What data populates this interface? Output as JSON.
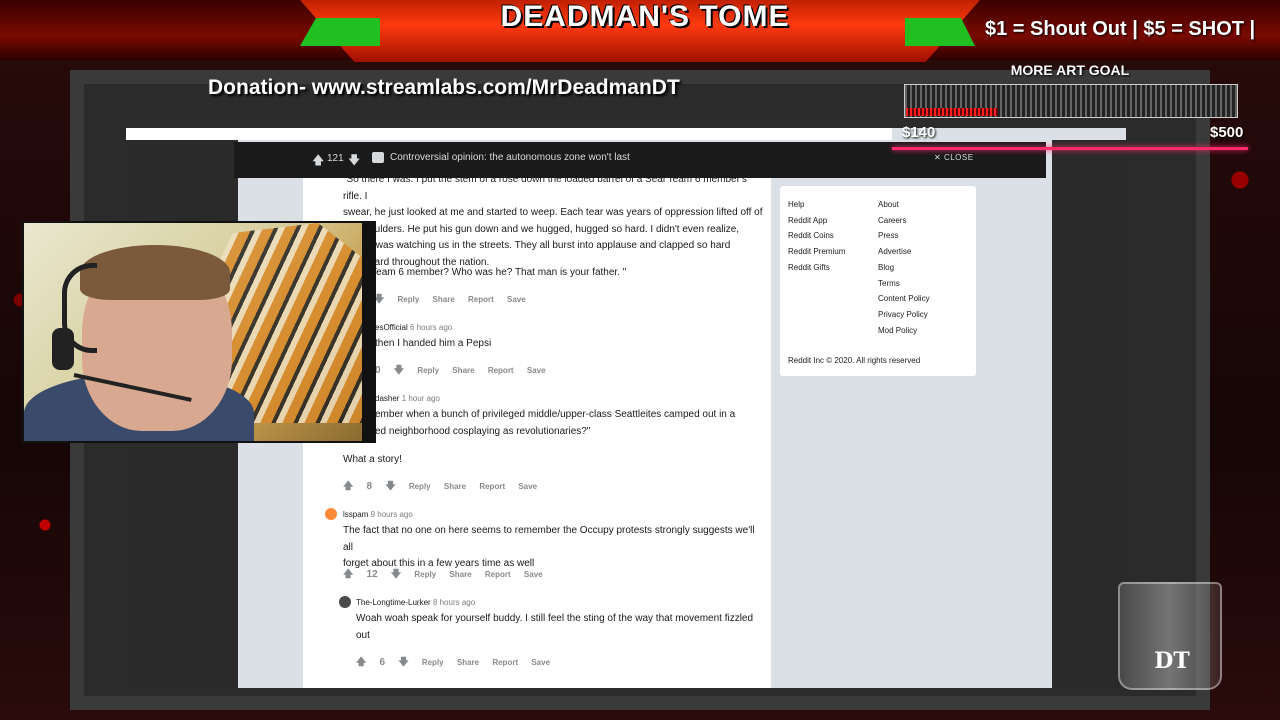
{
  "overlay": {
    "stream_title": "DEADMAN'S TOME",
    "shoutout": "$1 = Shout Out | $5 = SHOT |",
    "donation": "Donation- www.streamlabs.com/MrDeadmanDT",
    "goal": {
      "title": "MORE ART GOAL",
      "current": "$140",
      "target": "$500",
      "progress": 0.28
    },
    "logo_text": "DT",
    "colors": {
      "accent": "#ff2a10",
      "green": "#20c020",
      "goal_line": "#ff2a6a"
    }
  },
  "top_post_bar": {
    "vote_count": "121",
    "title": "Controversial opinion: the autonomous zone won't last",
    "close_label": "CLOSE"
  },
  "comments": [
    {
      "text_lines": [
        "\"So there I was. I put the stem of a rose down the loaded barrel of a Seal Team 6 member's rifle. I",
        "swear, he just looked at me and started to weep. Each tear was years of oppression lifted off of",
        "his shoulders. He put his gun down and we hugged, hugged so hard. I didn't even realize,",
        "people was watching us in the streets. They all burst into applause and clapped so hard",
        "was heard throughout the nation."
      ],
      "text_line2": "t Seal Team 6 member? Who was he? That man is your father. \"",
      "actions": [
        "Reply",
        "Share",
        "Report",
        "Save"
      ]
    },
    {
      "author": "esOfficial",
      "time": "6 hours ago",
      "text": "then I handed him a Pepsi",
      "votes": "0",
      "actions": [
        "Reply",
        "Share",
        "Report",
        "Save"
      ]
    },
    {
      "author": "dasher",
      "time": "1 hour ago",
      "text_lines": [
        "ember when a bunch of privileged middle/upper-class Seattleites camped out in a",
        "ed neighborhood cosplaying as revolutionaries?\""
      ],
      "text_after": "What a story!",
      "votes": "8",
      "actions": [
        "Reply",
        "Share",
        "Report",
        "Save"
      ]
    },
    {
      "author": "lsspam",
      "time": "9 hours ago",
      "text_lines": [
        "The fact that no one on here seems to remember the Occupy protests strongly suggests we'll all",
        "forget about this in a few years time as well"
      ],
      "votes": "12",
      "actions": [
        "Reply",
        "Share",
        "Report",
        "Save"
      ]
    },
    {
      "author": "The-Longtime-Lurker",
      "time": "8 hours ago",
      "text_lines": [
        "Woah woah speak for yourself buddy. I still feel the sting of the way that movement fizzled",
        "out"
      ],
      "votes": "6",
      "actions": [
        "Reply",
        "Share",
        "Report",
        "Save"
      ]
    }
  ],
  "sidebar": {
    "col1": [
      "Help",
      "Reddit App",
      "Reddit Coins",
      "Reddit Premium",
      "Reddit Gifts"
    ],
    "col2": [
      "About",
      "Careers",
      "Press",
      "Advertise",
      "Blog",
      "Terms",
      "Content Policy",
      "Privacy Policy",
      "Mod Policy"
    ],
    "copyright": "Reddit Inc © 2020. All rights reserved"
  }
}
